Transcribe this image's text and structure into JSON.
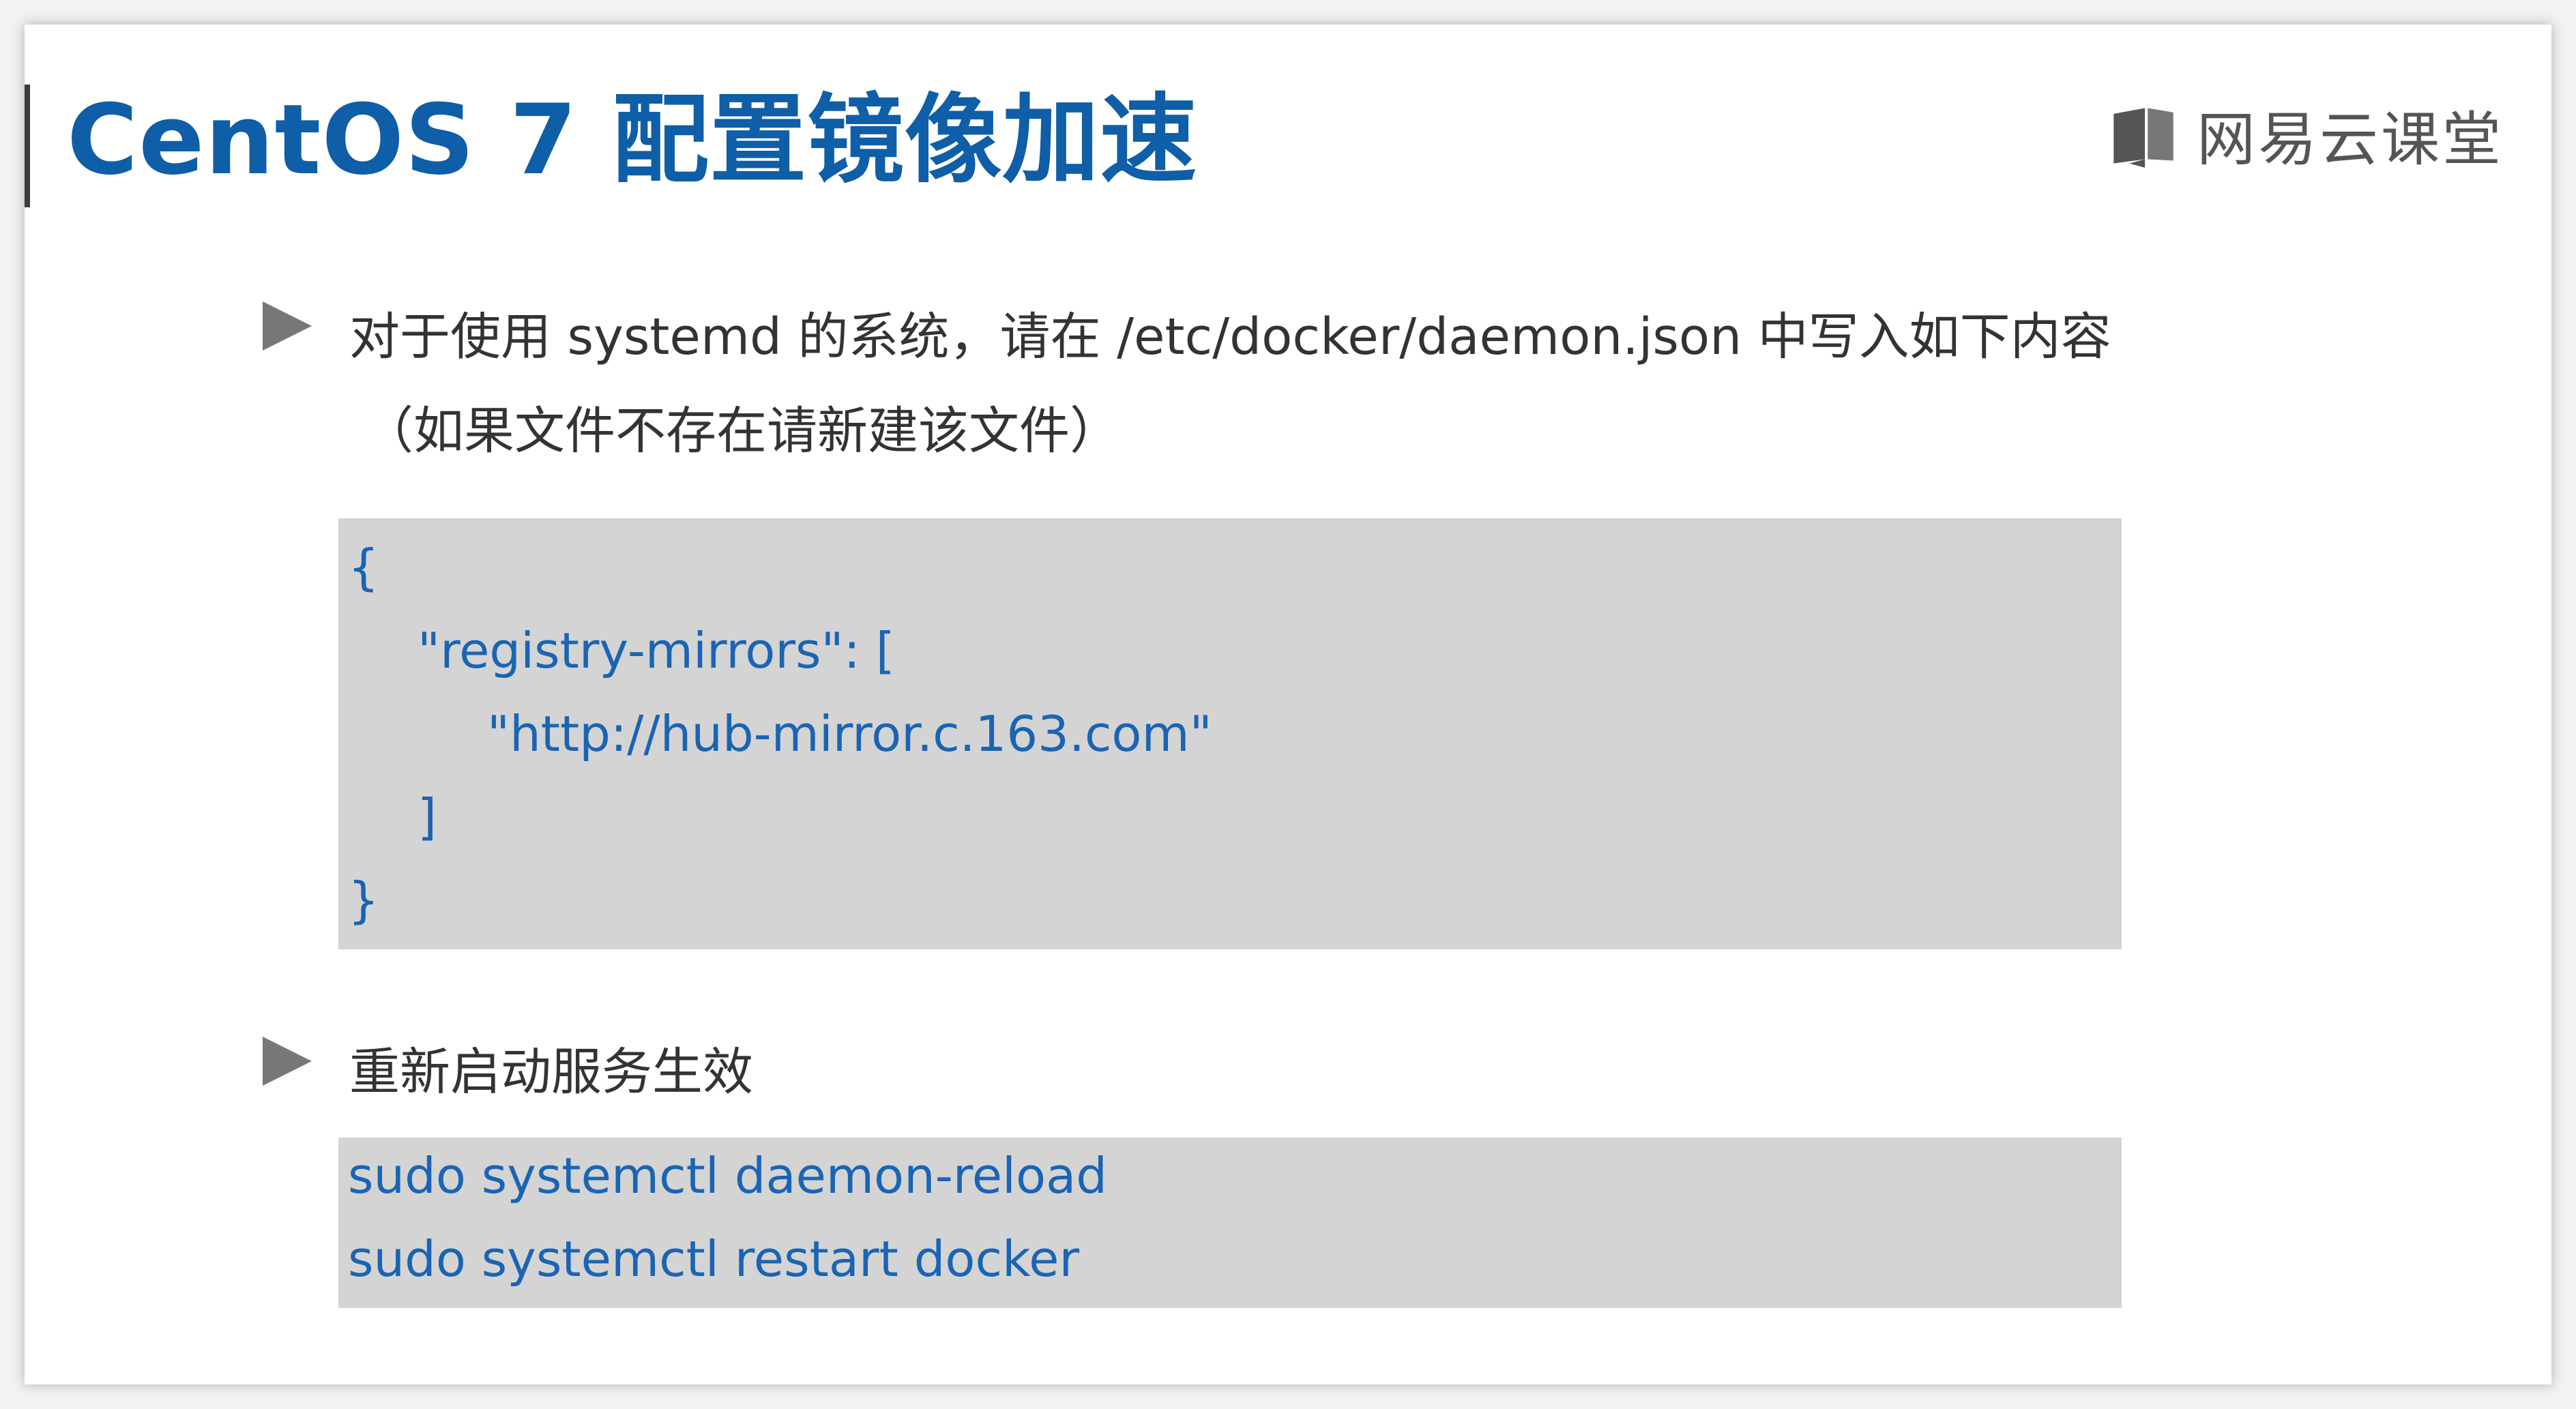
{
  "slide": {
    "title": "CentOS 7 配置镜像加速",
    "brand": {
      "name": "网易云课堂",
      "icon": "book-icon",
      "icon_color": "#555555"
    },
    "colors": {
      "title": "#0f5ea8",
      "code_text": "#1a64b4",
      "code_background": "#d4d4d4",
      "body_text": "#333333"
    },
    "sections": [
      {
        "bullet_icon": "triangle-bullet-icon",
        "lines": [
          "对于使用 systemd 的系统，请在 /etc/docker/daemon.json 中写入如下内容",
          "（如果文件不存在请新建该文件）"
        ],
        "code": [
          "{",
          "\"registry-mirrors\": [",
          "\"http://hub-mirror.c.163.com\"",
          "]",
          "}"
        ]
      },
      {
        "bullet_icon": "triangle-bullet-icon",
        "lines": [
          "重新启动服务生效"
        ],
        "code": [
          "sudo systemctl daemon-reload",
          "sudo systemctl restart docker"
        ]
      }
    ]
  }
}
